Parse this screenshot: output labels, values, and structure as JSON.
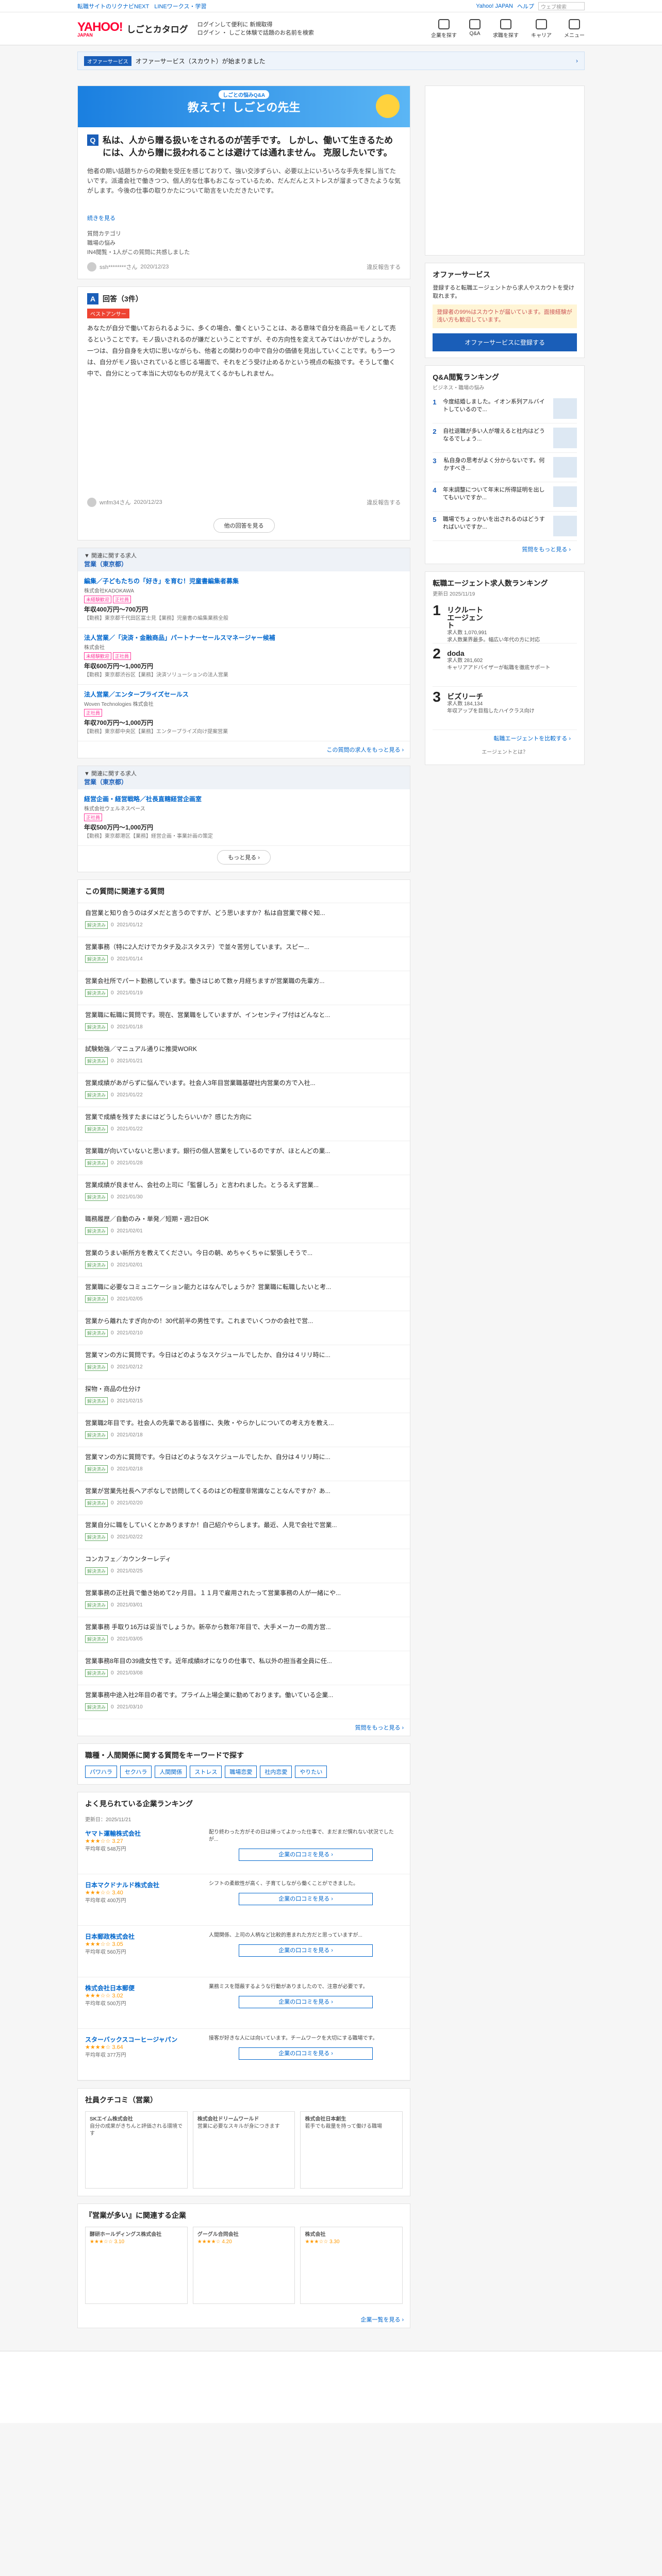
{
  "topnav": {
    "left1": "転職サイトのリクナビNEXT",
    "left2": "LINEワークス・学習",
    "yjapan": "Yahoo! JAPAN",
    "help": "ヘルプ",
    "search_placeholder": "ウェブ検索"
  },
  "header": {
    "logo": "YAHOO!",
    "logo_sub": "JAPAN",
    "brand": "しごとカタログ",
    "info1": "ログインして便利に 新規取得",
    "info2": "ログイン ・ しごと体験で話題のお名前を検索",
    "icons": [
      "企業を探す",
      "Q&A",
      "求職を探す",
      "キャリア",
      "メニュー"
    ]
  },
  "offerbar": {
    "badge": "オファーサービス",
    "text": "オファーサービス（スカウト）が始まりました"
  },
  "banner": {
    "tag": "しごとの悩みQ&A",
    "title": "教えて！しごとの先生"
  },
  "question": {
    "title": "私は、人から贈る扱いをされるのが苦手です。 しかし、働いて生きるためには、人から贈に扱われることは避けては通れません。 克服したいです。",
    "body": "他者の期い話題ちからの発動を受圧を感じておりて、強い交渉ずらい、必要以上にいろいろな手先を探し当てたいです。派遣会社で働きつつ、個人的な仕事もおこなっているため、だんだんとストレスが溜まってきたような気がします。今後の仕事の取りかたについて助言をいただきたいです。",
    "more": "続きを見る",
    "cat_label": "質問カテゴリ",
    "cat1": "職場の悩み",
    "cat2": "IN4閲覧・1人がこの質問に共感しました",
    "user": "ssh********さん",
    "date": "2020/12/23",
    "report": "違反報告する"
  },
  "answers": {
    "title": "回答（3件）",
    "tag": "ベストアンサー",
    "text": "あなたが自分で働いておられるように、多くの場合、働くということは、ある意味で自分を商品＝モノとして売るということです。モノ扱いされるのが嫌だということですが、その方向性を変えてみてはいかがでしょうか。一つは、自分自身を大切に思いながらも、他者との関わりの中で自分の価値を見出していくことです。もう一つは、自分がモノ扱いされていると感じる場面で、それをどう受け止めるかという視点の転換です。そうして働く中で、自分にとって本当に大切なものが見えてくるかもしれません。",
    "user": "wnfm34さん",
    "date": "2020/12/23",
    "report": "違反報告する",
    "more_btn": "他の回答を見る"
  },
  "jobs1": {
    "h1": "▼ 関連に関する求人",
    "h2": "営業（東京都）",
    "items": [
      {
        "t": "編集／子どもたちの「好き」を育む！児童書編集者募集",
        "c": "株式会社KADOKAWA",
        "tags": [
          "未経験歓迎",
          "正社員"
        ],
        "s": "年収400万円〜700万円",
        "d": "【勤務】東京都千代田区富士見【業務】児童書の編集業務全般"
      },
      {
        "t": "法人営業／「決済・金融商品」パートナーセールスマネージャー候補",
        "c": "株式会社",
        "tags": [
          "未経験歓迎",
          "正社員"
        ],
        "s": "年収600万円〜1,000万円",
        "d": "【勤務】東京都渋谷区【業務】決済ソリューションの法人営業"
      },
      {
        "t": "法人営業／エンタープライズセールス",
        "c": "Woven Technologies 株式会社",
        "tags": [
          "正社員"
        ],
        "s": "年収700万円〜1,000万円",
        "d": "【勤務】東京都中央区【業務】エンタープライズ向け提案営業"
      }
    ],
    "more": "この質問の求人をもっと見る ›"
  },
  "jobs2": {
    "h1": "▼ 関連に関する求人",
    "h2": "営業（東京都）",
    "items": [
      {
        "t": "経営企画・経営戦略／社長直轄経営企画室",
        "c": "株式会社ウェルネスペース",
        "tags": [
          "正社員"
        ],
        "s": "年収500万円〜1,000万円",
        "d": "【勤務】東京都港区【業務】経営企画・事業計画の策定"
      }
    ],
    "more": "もっと見る ›"
  },
  "related": {
    "title": "この質問に関連する質問",
    "items": [
      {
        "t": "自営業と知り合うのはダメだと言うのですが、どう思いますか？私は自営業で稼ぐ知...",
        "n": "0",
        "d": "2021/01/12"
      },
      {
        "t": "営業事務（特に2人だけでカタチ及ぶスタステ）で並々苦労しています。スピー...",
        "n": "0",
        "d": "2021/01/14"
      },
      {
        "t": "営業会社所でパート勤務しています。働きはじめて数ヶ月経ちますが営業職の先輩方...",
        "n": "0",
        "d": "2021/01/19"
      },
      {
        "t": "営業職に転職に質問です。現在、営業職をしていますが、インセンティブ付はどんなと...",
        "n": "0",
        "d": "2021/01/18"
      },
      {
        "t": "試験勉強／マニュアル通りに推奨WORK",
        "n": "0",
        "d": "2021/01/21"
      },
      {
        "t": "営業成績があがらずに悩んでいます。社会人3年目営業職基礎社内営業の方で入社...",
        "n": "0",
        "d": "2021/01/22"
      },
      {
        "t": "営業で成績を残すたまにはどうしたらいいか？感じた方向に",
        "n": "0",
        "d": "2021/01/22"
      },
      {
        "t": "営業職が向いていないと思います。銀行の個人営業をしているのですが、ほとんどの業...",
        "n": "0",
        "d": "2021/01/28"
      },
      {
        "t": "営業成績が良ません、会社の上司に「監督しろ」と言われました。とうるえず営業...",
        "n": "0",
        "d": "2021/01/30"
      },
      {
        "t": "職務履歴／自動のみ・単発／短期・週2日OK",
        "n": "0",
        "d": "2021/02/01"
      },
      {
        "t": "営業のうまい新所方を教えてください。今日の朝、めちゃくちゃに緊張しそうで...",
        "n": "0",
        "d": "2021/02/01"
      },
      {
        "t": "営業職に必要なコミュニケーション能力とはなんでしょうか？営業職に転職したいと考...",
        "n": "0",
        "d": "2021/02/05"
      },
      {
        "t": "営業から離れたすぎ向かの！30代前半の男性です。これまでいくつかの会社で営...",
        "n": "0",
        "d": "2021/02/10"
      },
      {
        "t": "営業マンの方に質問です。今日はどのようなスケジュールでしたか、自分は４リリ時に...",
        "n": "0",
        "d": "2021/02/12"
      },
      {
        "t": "探物・商品の仕分け",
        "n": "0",
        "d": "2021/02/15"
      },
      {
        "t": "営業職2年目です。社会人の先輩である皆様に、失敗・やらかしについての考え方を教え...",
        "n": "0",
        "d": "2021/02/18"
      },
      {
        "t": "営業マンの方に質問です。今日はどのようなスケジュールでしたか、自分は４リリ時に...",
        "n": "0",
        "d": "2021/02/18"
      },
      {
        "t": "営業が営業先社長へアポなしで訪問してくるのはどの程度非常識なことなんですか？あ...",
        "n": "0",
        "d": "2021/02/20"
      },
      {
        "t": "営業自分に職をしていくとかありますか！自己紹介やらします。最近、人見で会社で営業...",
        "n": "0",
        "d": "2021/02/22"
      },
      {
        "t": "コンカフェ／カウンターレディ",
        "n": "0",
        "d": "2021/02/25"
      },
      {
        "t": "営業事務の正社員で働き始めて2ヶ月目。１１月で雇用されたって営業事務の人が一緒にや...",
        "n": "0",
        "d": "2021/03/01"
      },
      {
        "t": "営業事務 手取り16万は妥当でしょうか。新卒から数年7年目で、大手メーカーの周方営...",
        "n": "0",
        "d": "2021/03/05"
      },
      {
        "t": "営業事務8年目の39歳女性です。近年成績8才になりの仕事で、私以外の担当者全員に任...",
        "n": "0",
        "d": "2021/03/08"
      },
      {
        "t": "営業事務中途入社2年目の者です。プライム上場企業に勤めております。働いている企業...",
        "n": "0",
        "d": "2021/03/10"
      }
    ],
    "more": "質問をもっと見る ›"
  },
  "keywords": {
    "title": "職種・人間関係に関する質問をキーワードで探す",
    "items": [
      "パワハラ",
      "セクハラ",
      "人間関係",
      "ストレス",
      "職場恋愛",
      "社内恋愛",
      "やりたい"
    ]
  },
  "ranking": {
    "title": "よく見られている企業ランキング",
    "sub": "更新日：2025/11/21",
    "more": "もっと見る ›",
    "items": [
      {
        "n": "ヤマト運輸株式会社",
        "st": "★★★☆☆ 3.27",
        "x": "平均年収 548万円",
        "r": "配り終わった方がその日は帰ってよかった仕事で、まだまだ慣れない状況でしたが..."
      },
      {
        "n": "日本マクドナルド株式会社",
        "st": "★★★☆☆ 3.40",
        "x": "平均年収 400万円",
        "r": "シフトの柔軟性が高く、子育てしながら働くことができました。"
      },
      {
        "n": "日本郵政株式会社",
        "st": "★★★☆☆ 3.05",
        "x": "平均年収 560万円",
        "r": "人間関係、上司の人柄など比較的恵まれた方だと思っていますが..."
      },
      {
        "n": "株式会社日本郵便",
        "st": "★★★☆☆ 3.02",
        "x": "平均年収 500万円",
        "r": "業務ミスを隠蔽するような行動がありましたので、注意が必要です。"
      },
      {
        "n": "スターバックスコーヒージャパン",
        "st": "★★★★☆ 3.64",
        "x": "平均年収 377万円",
        "r": "接客が好きな人には向いています。チームワークを大切にする職場です。"
      }
    ],
    "btn": "企業の口コミを見る ›"
  },
  "kuchikomi": {
    "title": "社員クチコミ（営業）",
    "items": [
      {
        "n": "SKエイム株式会社",
        "t": "自分の成果がきちんと評価される環境です"
      },
      {
        "n": "株式会社ドリームワールド",
        "t": "営業に必要なスキルが身につきます"
      },
      {
        "n": "株式会社日本創生",
        "t": "若手でも裁量を持って働ける職場"
      }
    ]
  },
  "kuchikomi2": {
    "title": "『営業が多い』に関連する企業",
    "more": "企業一覧を見る ›",
    "items": [
      {
        "n": "酵研ホールディングス株式会社",
        "st": "★★★☆☆ 3.10"
      },
      {
        "n": "グーグル合同会社",
        "st": "★★★★☆ 4.20"
      },
      {
        "n": "株式会社",
        "st": "★★★☆☆ 3.30"
      }
    ]
  },
  "side": {
    "offer": {
      "title": "オファーサービス",
      "p": "登録すると転職エージェントから求人やスカウトを受け取れます。",
      "hl": "登録者の99%はスカウトが届いています。面接経験が浅い方も歓迎しています。",
      "btn": "オファーサービスに登録する"
    },
    "qa": {
      "title": "Q&A閲覧ランキング",
      "sub": "ビジネス・職場の悩み",
      "items": [
        {
          "n": "1",
          "t": "今度結婚しました。イオン系列アルバイトしているので..."
        },
        {
          "n": "2",
          "t": "自社退職が多い人が増えると社内はどうなるでしょう..."
        },
        {
          "n": "3",
          "t": "私自身の思考がよく分からないです。何かすべき..."
        },
        {
          "n": "4",
          "t": "年末調整について年末に所得証明を出してもいいですか..."
        },
        {
          "n": "5",
          "t": "職場でちょっかいを出されるのはどうすればいいですか..."
        }
      ],
      "more": "質問をもっと見る ›"
    },
    "agents": {
      "title": "転職エージェント求人数ランキング",
      "sub": "更新日 2025/11/19",
      "items": [
        {
          "n": "1",
          "lg": "リクルートエージェント",
          "t": "求人数 1,070,991",
          "d": "求人数業界最多。幅広い年代の方に対応"
        },
        {
          "n": "2",
          "lg": "doda",
          "t": "求人数 281,602",
          "d": "キャリアアドバイザーが転職を徹底サポート"
        },
        {
          "n": "3",
          "lg": "ビズリーチ",
          "t": "求人数 184,134",
          "d": "年収アップを目指したハイクラス向け"
        }
      ],
      "more": "転職エージェントを比較する ›",
      "note": "エージェントとは？"
    }
  }
}
